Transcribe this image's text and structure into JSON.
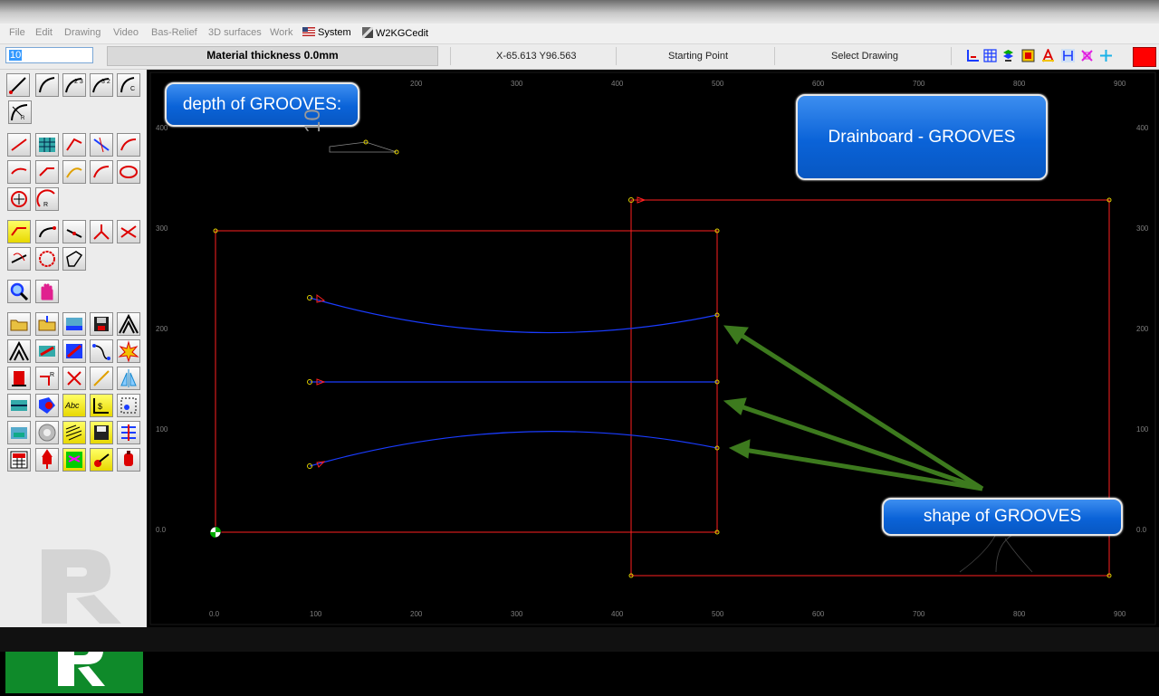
{
  "menu": {
    "items": [
      "File",
      "Edit",
      "Drawing",
      "Video",
      "Bas-Relief",
      "3D surfaces",
      "Work"
    ],
    "system_label": "System",
    "editor_label": "W2KGCedit"
  },
  "infobar": {
    "input_value": "10",
    "material": "Material thickness 0.0mm",
    "coords": "X-65.613 Y96.563",
    "mode": "Starting Point",
    "action": "Select Drawing"
  },
  "canvas": {
    "depth_callout": "depth of GROOVES:",
    "title_callout": "Drainboard - GROOVES",
    "shape_callout": "shape of GROOVES",
    "depth_value": "10",
    "x_ticks": [
      "0.0",
      "100",
      "200",
      "300",
      "400",
      "500",
      "600",
      "700",
      "800",
      "900"
    ],
    "y_ticks": [
      "0.0",
      "100",
      "200",
      "300",
      "400"
    ],
    "top_ticks": [
      "200",
      "300",
      "400",
      "500",
      "600",
      "700",
      "800",
      "900"
    ]
  },
  "colors": {
    "outline": "#ff2020",
    "groove": "#1a3cff",
    "arrow": "#3d7a1e",
    "callout": "#0a63d8"
  }
}
